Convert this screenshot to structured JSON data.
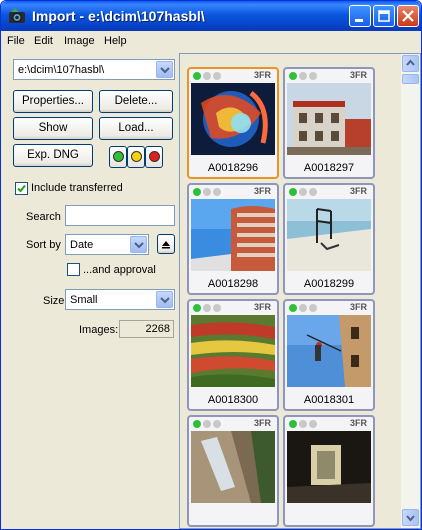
{
  "window": {
    "title": "Import - e:\\dcim\\107hasbl\\"
  },
  "menu": [
    "File",
    "Edit",
    "Image",
    "Help"
  ],
  "folder_combo": {
    "value": "e:\\dcim\\107hasbl\\"
  },
  "buttons": {
    "properties": "Properties...",
    "delete": "Delete...",
    "show": "Show",
    "load": "Load...",
    "exp_dng": "Exp. DNG"
  },
  "include_transferred": {
    "label": "Include transferred",
    "checked": true
  },
  "search": {
    "label": "Search",
    "value": ""
  },
  "sort_by": {
    "label": "Sort by",
    "value": "Date"
  },
  "and_approval": {
    "label": "...and approval",
    "checked": false
  },
  "size": {
    "label": "Size",
    "value": "Small"
  },
  "images_count": {
    "label": "Images:",
    "value": "2268"
  },
  "colors": {
    "green": "#2fbf3a",
    "yellow": "#f5d20a",
    "red": "#e21d1d",
    "selected_border": "#e89426"
  },
  "thumbnails": [
    {
      "name": "A0018296",
      "ext": "3FR"
    },
    {
      "name": "A0018297",
      "ext": "3FR"
    },
    {
      "name": "A0018298",
      "ext": "3FR"
    },
    {
      "name": "A0018299",
      "ext": "3FR"
    },
    {
      "name": "A0018300",
      "ext": "3FR"
    },
    {
      "name": "A0018301",
      "ext": "3FR"
    },
    {
      "name": "",
      "ext": "3FR"
    },
    {
      "name": "",
      "ext": "3FR"
    }
  ]
}
